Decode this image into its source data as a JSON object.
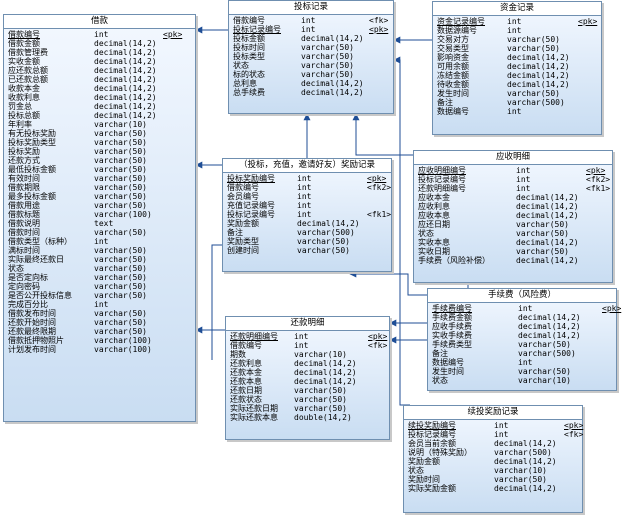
{
  "tables": {
    "loan": {
      "title": "借款",
      "rows": [
        [
          "借款编号",
          "int",
          "<pk>"
        ],
        [
          "借款金额",
          "decimal(14,2)",
          ""
        ],
        [
          "借款管理费",
          "decimal(14,2)",
          ""
        ],
        [
          "实收金额",
          "decimal(14,2)",
          ""
        ],
        [
          "应还款总额",
          "decimal(14,2)",
          ""
        ],
        [
          "已还款总额",
          "decimal(14,2)",
          ""
        ],
        [
          "收款本金",
          "decimal(14,2)",
          ""
        ],
        [
          "收款利息",
          "decimal(14,2)",
          ""
        ],
        [
          "罚金总",
          "decimal(14,2)",
          ""
        ],
        [
          "投标总额",
          "decimal(14,2)",
          ""
        ],
        [
          "年利率",
          "varchar(10)",
          ""
        ],
        [
          "有无投标奖励",
          "varchar(50)",
          ""
        ],
        [
          "投标奖励类型",
          "varchar(50)",
          ""
        ],
        [
          "投标奖励",
          "varchar(50)",
          ""
        ],
        [
          "还款方式",
          "varchar(50)",
          ""
        ],
        [
          "最低投标金额",
          "varchar(50)",
          ""
        ],
        [
          "有效时间",
          "varchar(50)",
          ""
        ],
        [
          "借款期限",
          "varchar(50)",
          ""
        ],
        [
          "最多投标金额",
          "varchar(50)",
          ""
        ],
        [
          "借款用途",
          "varchar(50)",
          ""
        ],
        [
          "借款标题",
          "varchar(100)",
          ""
        ],
        [
          "借款说明",
          "text",
          ""
        ],
        [
          "借款时间",
          "varchar(50)",
          ""
        ],
        [
          "借款类型（标种）",
          "int",
          ""
        ],
        [
          "满标时间",
          "varchar(50)",
          ""
        ],
        [
          "实际最终还款日",
          "varchar(50)",
          ""
        ],
        [
          "状态",
          "varchar(50)",
          ""
        ],
        [
          "是否定向标",
          "varchar(50)",
          ""
        ],
        [
          "定向密码",
          "varchar(50)",
          ""
        ],
        [
          "是否公开投标信息",
          "varchar(50)",
          ""
        ],
        [
          "完成百分比",
          "int",
          ""
        ],
        [
          "借款发布时间",
          "varchar(50)",
          ""
        ],
        [
          "还款开始时间",
          "varchar(50)",
          ""
        ],
        [
          "还款最终限期",
          "varchar(50)",
          ""
        ],
        [
          "借款抵押物照片",
          "varchar(100)",
          ""
        ],
        [
          "计划发布时间",
          "varchar(100)",
          ""
        ]
      ]
    },
    "bid": {
      "title": "投标记录",
      "rows": [
        [
          "借款编号",
          "int",
          "<fk>"
        ],
        [
          "投标记录编号",
          "int",
          "<pk>"
        ],
        [
          "投标金额",
          "decimal(14,2)",
          ""
        ],
        [
          "投标时间",
          "varchar(50)",
          ""
        ],
        [
          "投标类型",
          "varchar(50)",
          ""
        ],
        [
          "状态",
          "varchar(50)",
          ""
        ],
        [
          "标的状态",
          "varchar(50)",
          ""
        ],
        [
          "总利息",
          "decimal(14,2)",
          ""
        ],
        [
          "总手续费",
          "decimal(14,2)",
          ""
        ]
      ]
    },
    "fund": {
      "title": "资金记录",
      "rows": [
        [
          "资金记录编号",
          "int",
          "<pk>"
        ],
        [
          "数据源编号",
          "int",
          ""
        ],
        [
          "交易对方",
          "varchar(50)",
          ""
        ],
        [
          "交易类型",
          "varchar(50)",
          ""
        ],
        [
          "影响资金",
          "decimal(14,2)",
          ""
        ],
        [
          "可用余额",
          "decimal(14,2)",
          ""
        ],
        [
          "冻结金额",
          "decimal(14,2)",
          ""
        ],
        [
          "待收金额",
          "decimal(14,2)",
          ""
        ],
        [
          "发生时间",
          "varchar(50)",
          ""
        ],
        [
          "备注",
          "varchar(500)",
          ""
        ],
        [
          "数据编号",
          "int",
          ""
        ]
      ]
    },
    "reward": {
      "title": "（投标，充值，邀请好友）奖励记录",
      "rows": [
        [
          "投标奖励编号",
          "int",
          "<pk>"
        ],
        [
          "借款编号",
          "int",
          "<fk2>"
        ],
        [
          "会员编号",
          "int",
          ""
        ],
        [
          "充值记录编号",
          "int",
          ""
        ],
        [
          "投标记录编号",
          "int",
          "<fk1>"
        ],
        [
          "奖励金额",
          "decimal(14,2)",
          ""
        ],
        [
          "备注",
          "varchar(500)",
          ""
        ],
        [
          "奖励类型",
          "varchar(50)",
          ""
        ],
        [
          "创建时间",
          "varchar(50)",
          ""
        ]
      ]
    },
    "receivable": {
      "title": "应收明细",
      "rows": [
        [
          "应收明细编号",
          "int",
          "<pk>"
        ],
        [
          "投标记录编号",
          "int",
          "<fk2>"
        ],
        [
          "还款明细编号",
          "int",
          "<fk1>"
        ],
        [
          "应收本金",
          "decimal(14,2)",
          ""
        ],
        [
          "应收利息",
          "decimal(14,2)",
          ""
        ],
        [
          "应收本息",
          "decimal(14,2)",
          ""
        ],
        [
          "应还日期",
          "varchar(50)",
          ""
        ],
        [
          "状态",
          "varchar(50)",
          ""
        ],
        [
          "实收本息",
          "decimal(14,2)",
          ""
        ],
        [
          "实收日期",
          "varchar(50)",
          ""
        ],
        [
          "手续费（风险补偿）",
          "decimal(14,2)",
          ""
        ]
      ]
    },
    "fee": {
      "title": "手续费（风险费）",
      "rows": [
        [
          "手续费编号",
          "int",
          "<pk>"
        ],
        [
          "手续费金额",
          "decimal(14,2)",
          ""
        ],
        [
          "应收手续费",
          "decimal(14,2)",
          ""
        ],
        [
          "实收手续费",
          "decimal(14,2)",
          ""
        ],
        [
          "手续费类型",
          "varchar(50)",
          ""
        ],
        [
          "备注",
          "varchar(500)",
          ""
        ],
        [
          "数据编号",
          "int",
          ""
        ],
        [
          "发生时间",
          "varchar(50)",
          ""
        ],
        [
          "状态",
          "varchar(10)",
          ""
        ]
      ]
    },
    "repay": {
      "title": "还款明细",
      "rows": [
        [
          "还款明细编号",
          "int",
          "<pk>"
        ],
        [
          "借款编号",
          "int",
          "<fk>"
        ],
        [
          "期数",
          "varchar(10)",
          ""
        ],
        [
          "还款利息",
          "decimal(14,2)",
          ""
        ],
        [
          "还款本金",
          "decimal(14,2)",
          ""
        ],
        [
          "还款本息",
          "decimal(14,2)",
          ""
        ],
        [
          "还款日期",
          "varchar(50)",
          ""
        ],
        [
          "还款状态",
          "varchar(50)",
          ""
        ],
        [
          "实际还款日期",
          "varchar(50)",
          ""
        ],
        [
          "实际还款本息",
          "double(14,2)",
          ""
        ]
      ]
    },
    "renew": {
      "title": "续投奖励记录",
      "rows": [
        [
          "续投奖励编号",
          "int",
          "<pk>"
        ],
        [
          "投标记录编号",
          "int",
          "<fk>"
        ],
        [
          "会员当前余额",
          "decimal(14,2)",
          ""
        ],
        [
          "说明（特殊奖励）",
          "varchar(500)",
          ""
        ],
        [
          "奖励金额",
          "decimal(14,2)",
          ""
        ],
        [
          "状态",
          "varchar(10)",
          ""
        ],
        [
          "奖励时间",
          "varchar(50)",
          ""
        ],
        [
          "实际奖励金额",
          "decimal(14,2)",
          ""
        ]
      ]
    }
  }
}
